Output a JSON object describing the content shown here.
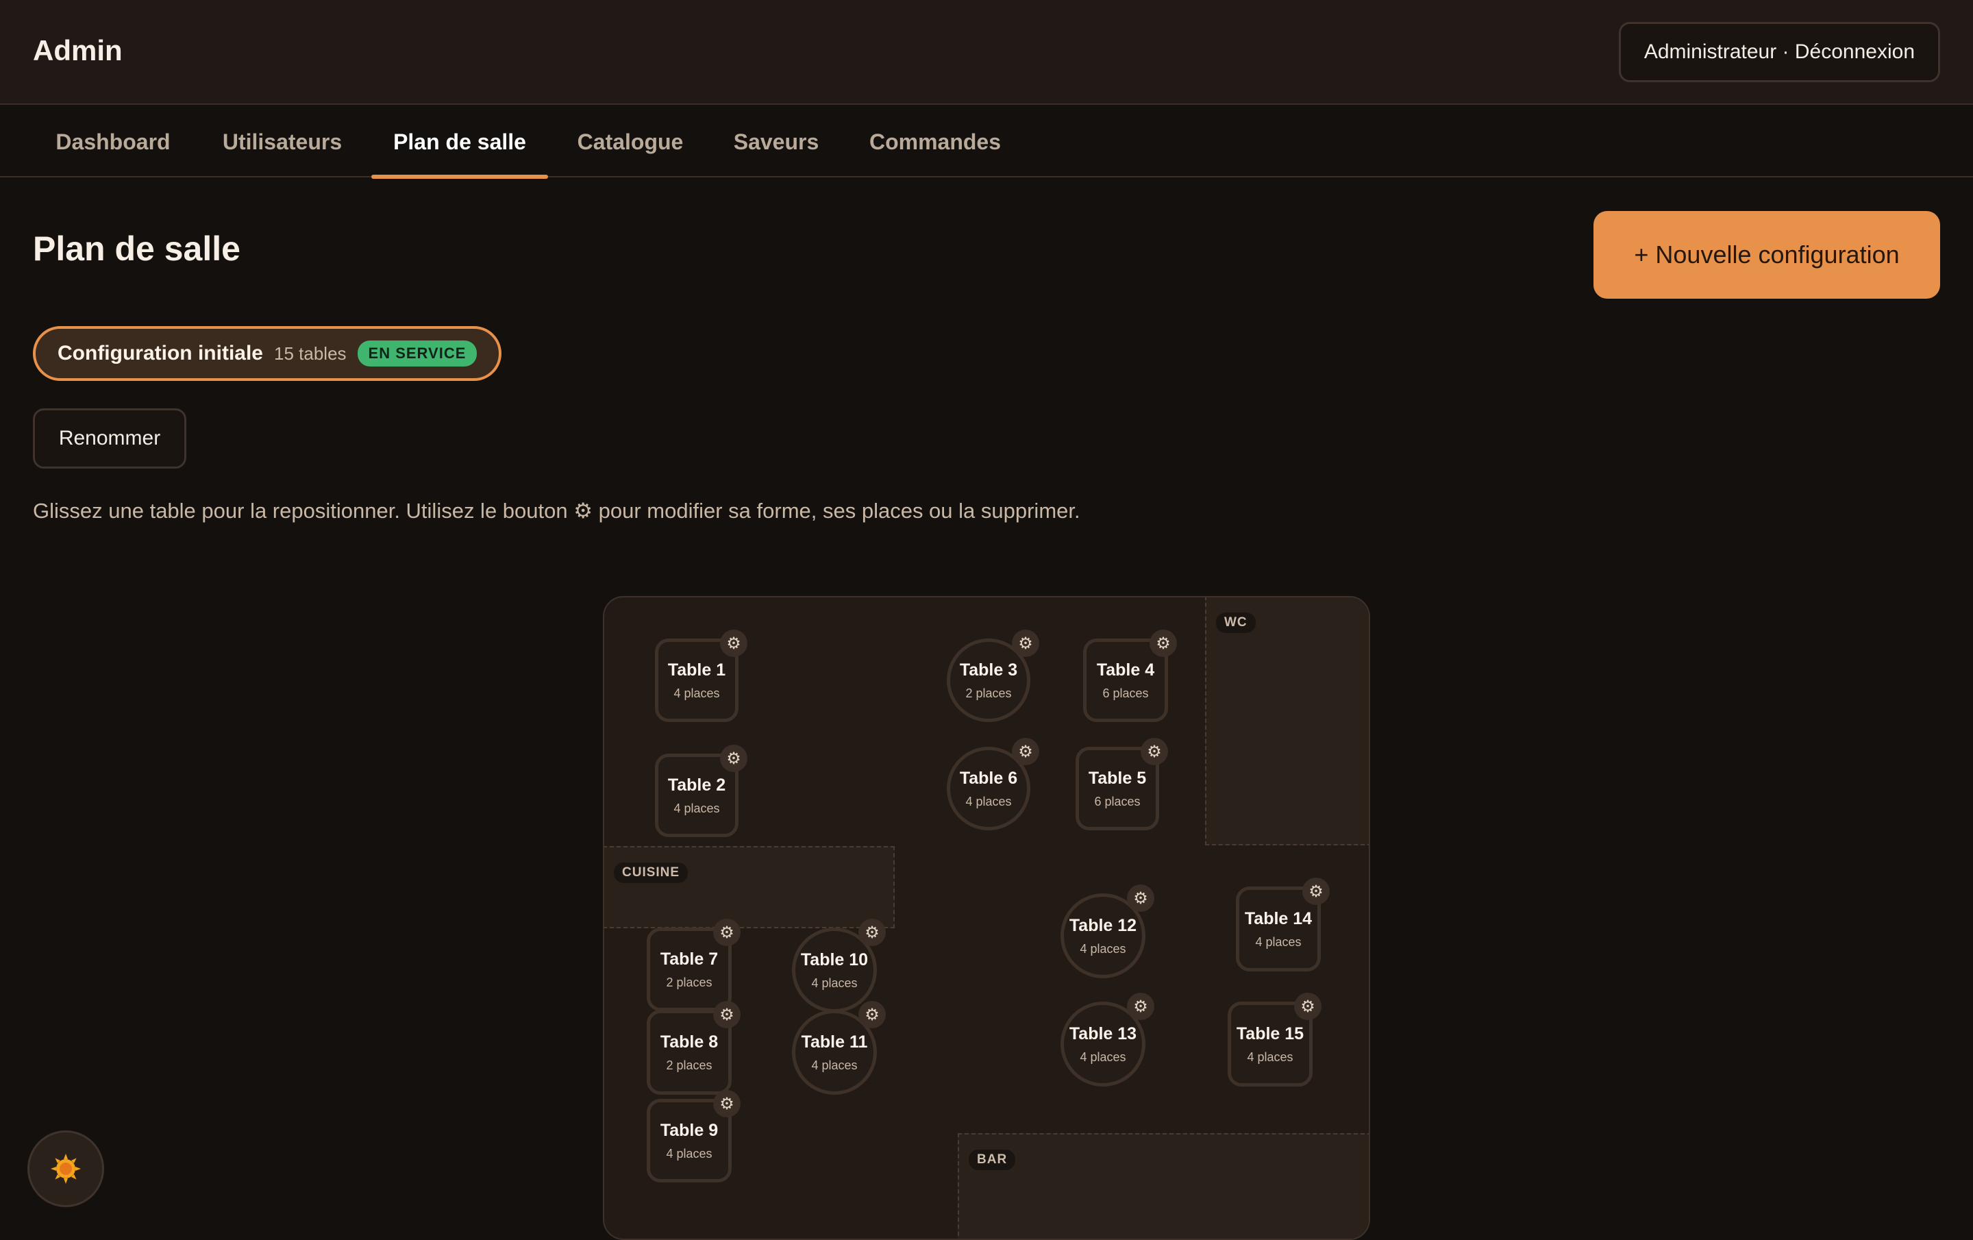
{
  "header": {
    "title": "Admin",
    "account_label": "Administrateur · Déconnexion"
  },
  "nav": {
    "tabs": [
      {
        "label": "Dashboard"
      },
      {
        "label": "Utilisateurs"
      },
      {
        "label": "Plan de salle",
        "active": true
      },
      {
        "label": "Catalogue"
      },
      {
        "label": "Saveurs"
      },
      {
        "label": "Commandes"
      }
    ]
  },
  "main": {
    "title": "Plan de salle",
    "new_config_label": "+ Nouvelle configuration",
    "config": {
      "name": "Configuration initiale",
      "count": "15 tables",
      "status": "EN SERVICE"
    },
    "rename_label": "Renommer",
    "help_text": "Glissez une table pour la repositionner. Utilisez le bouton ⚙ pour modifier sa forme, ses places ou la supprimer."
  },
  "floor": {
    "zones": [
      {
        "label": "WC"
      },
      {
        "label": "CUISINE"
      },
      {
        "label": "BAR"
      }
    ],
    "tables": [
      {
        "name": "Table 1",
        "seats": "4 places",
        "shape": "square"
      },
      {
        "name": "Table 2",
        "seats": "4 places",
        "shape": "square"
      },
      {
        "name": "Table 3",
        "seats": "2 places",
        "shape": "round"
      },
      {
        "name": "Table 4",
        "seats": "6 places",
        "shape": "square"
      },
      {
        "name": "Table 5",
        "seats": "6 places",
        "shape": "square"
      },
      {
        "name": "Table 6",
        "seats": "4 places",
        "shape": "round"
      },
      {
        "name": "Table 7",
        "seats": "2 places",
        "shape": "square"
      },
      {
        "name": "Table 8",
        "seats": "2 places",
        "shape": "square"
      },
      {
        "name": "Table 9",
        "seats": "4 places",
        "shape": "square"
      },
      {
        "name": "Table 10",
        "seats": "4 places",
        "shape": "round"
      },
      {
        "name": "Table 11",
        "seats": "4 places",
        "shape": "round"
      },
      {
        "name": "Table 12",
        "seats": "4 places",
        "shape": "round"
      },
      {
        "name": "Table 13",
        "seats": "4 places",
        "shape": "round"
      },
      {
        "name": "Table 14",
        "seats": "4 places",
        "shape": "square"
      },
      {
        "name": "Table 15",
        "seats": "4 places",
        "shape": "square"
      }
    ],
    "gear_icon": "gear-icon"
  },
  "theme": {
    "icon": "sun-icon",
    "accent": "#e8914a",
    "status_color": "#3fb56e"
  }
}
